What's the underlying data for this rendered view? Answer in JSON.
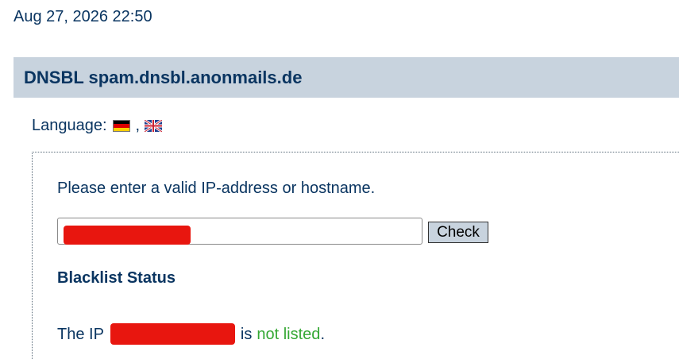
{
  "timestamp": "Aug 27, 2026 22:50",
  "header": {
    "title": "DNSBL spam.dnsbl.anonmails.de"
  },
  "language": {
    "label": "Language:",
    "separator": ",",
    "options": [
      {
        "name": "german",
        "icon": "german-flag-icon"
      },
      {
        "name": "english",
        "icon": "uk-flag-icon"
      }
    ]
  },
  "lookup": {
    "prompt": "Please enter a valid IP-address or hostname.",
    "input_value": "[redacted]",
    "button_label": "Check"
  },
  "status": {
    "heading": "Blacklist Status",
    "prefix": "The IP",
    "ip_value": "[redacted]",
    "middle": "is",
    "result": "not listed",
    "suffix": ".",
    "result_color": "#35a834"
  },
  "colors": {
    "text": "#0a3561",
    "header_bg": "#c8d3de",
    "redaction": "#e8160f"
  }
}
